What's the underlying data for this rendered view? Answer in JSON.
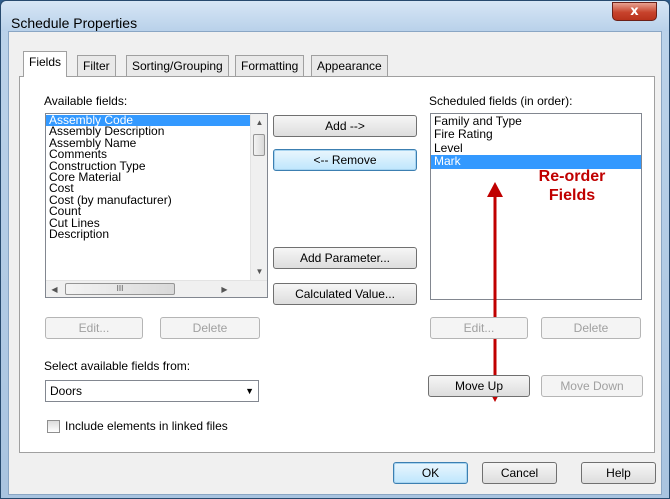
{
  "window": {
    "title": "Schedule Properties",
    "close_glyph": "x"
  },
  "tabs": [
    {
      "label": "Fields",
      "active": true
    },
    {
      "label": "Filter"
    },
    {
      "label": "Sorting/Grouping"
    },
    {
      "label": "Formatting"
    },
    {
      "label": "Appearance"
    }
  ],
  "available": {
    "label": "Available fields:",
    "items": [
      "Assembly Code",
      "Assembly Description",
      "Assembly Name",
      "Comments",
      "Construction Type",
      "Core Material",
      "Cost",
      "Cost (by manufacturer)",
      "Count",
      "Cut Lines",
      "Description"
    ],
    "selected_index": 0,
    "hscroll_thumb": "III"
  },
  "middle_buttons": {
    "add": "Add -->",
    "remove": "<-- Remove",
    "add_parameter": "Add Parameter...",
    "calculated_value": "Calculated Value..."
  },
  "scheduled": {
    "label": "Scheduled fields (in order):",
    "items": [
      "Family and Type",
      "Fire Rating",
      "Level",
      "Mark"
    ],
    "selected_index": 3
  },
  "left_actions": {
    "edit": "Edit...",
    "delete": "Delete"
  },
  "right_actions": {
    "edit": "Edit...",
    "delete": "Delete",
    "move_up": "Move Up",
    "move_down": "Move Down"
  },
  "select_from": {
    "label": "Select available fields from:",
    "value": "Doors"
  },
  "include_linked": {
    "label": "Include elements in linked files",
    "checked": false
  },
  "footer": {
    "ok": "OK",
    "cancel": "Cancel",
    "help": "Help"
  },
  "annotation": {
    "line1": "Re-order",
    "line2": "Fields",
    "color": "#c00000"
  },
  "colors": {
    "selection": "#3399ff",
    "title_bar": "#b9d1ea",
    "close_button": "#c7432c"
  }
}
